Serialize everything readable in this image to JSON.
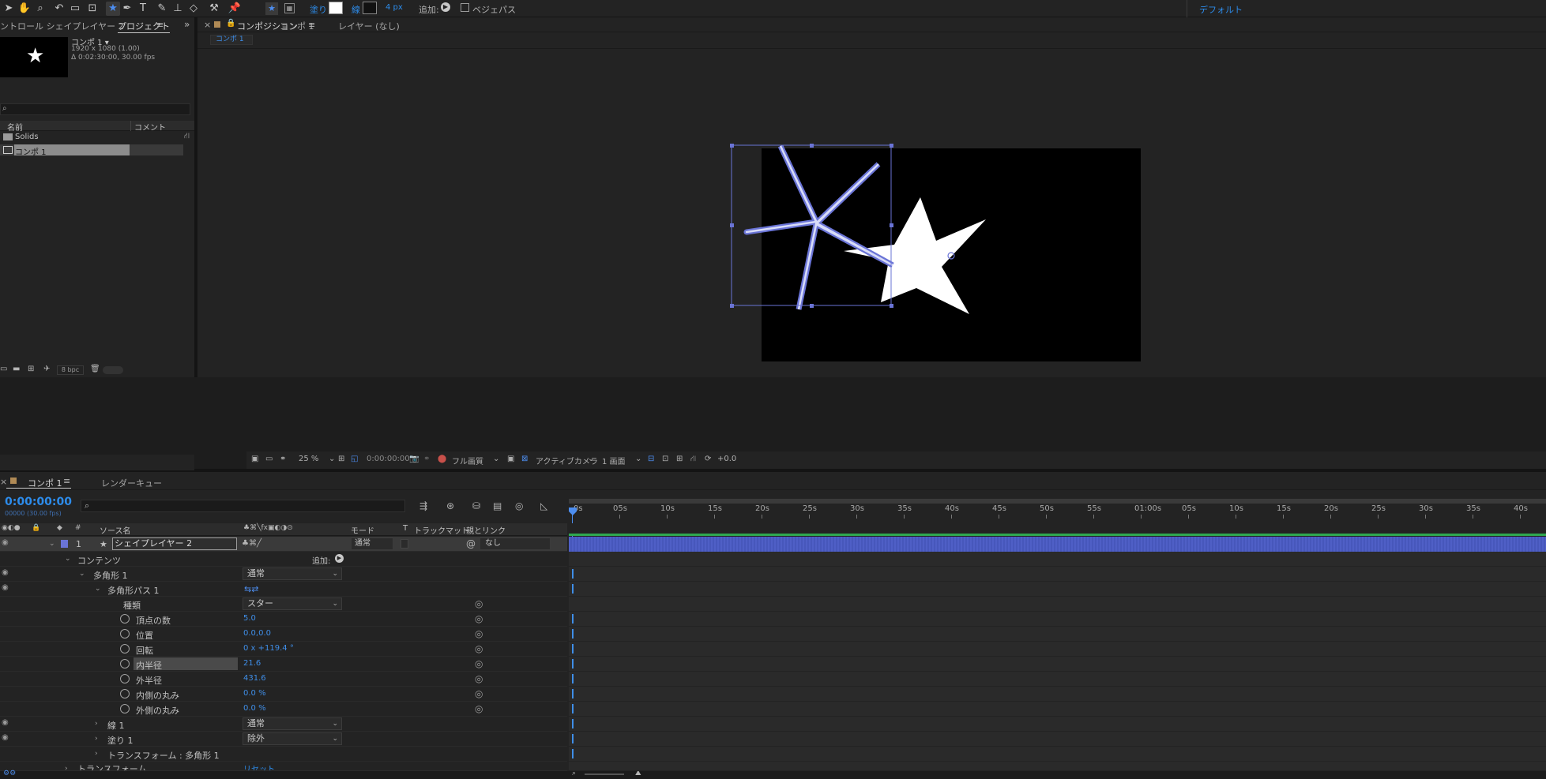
{
  "toolbar": {
    "fill_label": "塗り",
    "stroke_label": "線",
    "stroke_width": "4 px",
    "add_label": "追加:",
    "bezier_label": "ベジェパス",
    "workspace": "デフォルト"
  },
  "project_panel": {
    "tab_effect_controls": "ントロール シェイプレイヤー 2",
    "tab_project": "プロジェクト",
    "comp_name": "コンポ 1 ▾",
    "comp_resolution": "1920 x 1080 (1.00)",
    "comp_duration": "Δ 0:02:30:00, 30.00 fps",
    "col_name": "名前",
    "col_comment": "コメント",
    "items": [
      "Solids",
      "コンポ 1"
    ],
    "bpc": "8 bpc"
  },
  "composition_panel": {
    "tab_close": "×",
    "tab_prefix": "コンポジション",
    "tab_comp": "コンポ 1",
    "tab_layer": "レイヤー (なし)",
    "breadcrumb": "コンポ 1",
    "zoom": "25 %",
    "timecode": "0:00:00:00",
    "quality": "フル画質",
    "camera": "アクティブカメラ",
    "views": "1 画面",
    "exposure": "+0.0"
  },
  "timeline": {
    "tab_comp": "コンポ 1",
    "tab_render": "レンダーキュー",
    "timecode": "0:00:00:00",
    "frame_info": "00000 (30.00 fps)",
    "col_source": "ソース名",
    "col_mode": "モード",
    "col_t": "T",
    "col_trackmatte": "トラックマット",
    "col_parent": "親とリンク",
    "layer_number": "1",
    "layer_name": "シェイプレイヤー 2",
    "layer_mode": "通常",
    "layer_parent": "なし",
    "rows": {
      "contents": "コンテンツ",
      "contents_add": "追加:",
      "polygon": "多角形 1",
      "polygon_mode": "通常",
      "polypath": "多角形パス 1",
      "type_label": "種類",
      "type_value": "スター",
      "points_label": "頂点の数",
      "points_value": "5.0",
      "position_label": "位置",
      "position_value": "0.0,0.0",
      "rotation_label": "回転",
      "rotation_value": "0 x +119.4 °",
      "inner_radius_label": "内半径",
      "inner_radius_value": "21.6",
      "outer_radius_label": "外半径",
      "outer_radius_value": "431.6",
      "inner_round_label": "内側の丸み",
      "inner_round_value": "0.0 %",
      "outer_round_label": "外側の丸み",
      "outer_round_value": "0.0 %",
      "stroke": "線 1",
      "stroke_mode": "通常",
      "fill": "塗り 1",
      "fill_mode": "除外",
      "transform_poly": "トランスフォーム : 多角形 1",
      "transform": "トランスフォーム",
      "transform_reset": "リセット"
    },
    "ruler": [
      "0s",
      "05s",
      "10s",
      "15s",
      "20s",
      "25s",
      "30s",
      "35s",
      "40s",
      "45s",
      "50s",
      "55s",
      "01:00s",
      "05s",
      "10s",
      "15s",
      "20s",
      "25s",
      "30s",
      "35s",
      "40s"
    ]
  }
}
